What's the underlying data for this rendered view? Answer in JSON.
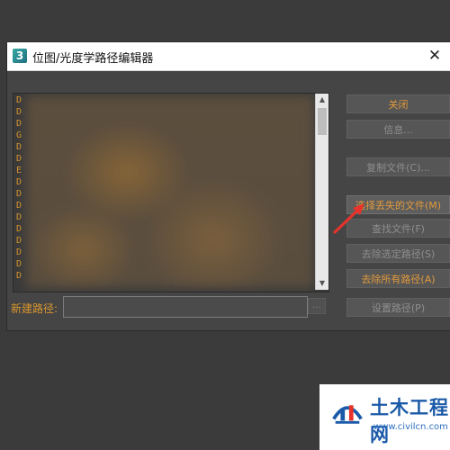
{
  "window": {
    "icon_text": "3",
    "title": "位图/光度学路径编辑器",
    "close_symbol": "✕"
  },
  "file_list": {
    "drive_prefixes": [
      "D",
      "D",
      "D",
      "G",
      "D",
      "D",
      "E",
      "D",
      "D",
      "D",
      "D",
      "D",
      "D",
      "D",
      "D",
      "D"
    ],
    "scroll_up": "▲",
    "scroll_down": "▼"
  },
  "buttons": {
    "close": "关闭",
    "info": "信息...",
    "copy_files": "复制文件(C)...",
    "select_missing": "选择丢失的文件(M)",
    "find_files": "查找文件(F)",
    "strip_selected": "去除选定路径(S)",
    "strip_all": "去除所有路径(A)",
    "set_path": "设置路径(P)"
  },
  "new_path": {
    "label": "新建路径:",
    "value": "",
    "browse": "..."
  },
  "watermark": {
    "brand": "土木工程网",
    "url": "www.civilcn.com"
  },
  "colors": {
    "accent_orange": "#e29a3c",
    "annotation_arrow": "#e8322a",
    "dialog_bg": "#454545"
  }
}
